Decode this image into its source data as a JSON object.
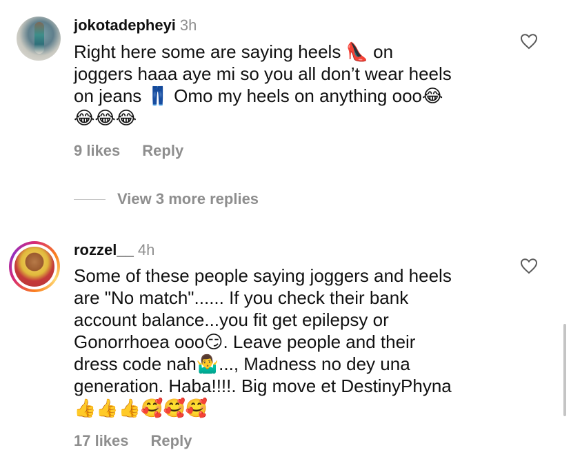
{
  "comments": [
    {
      "username": "jokotadepheyi",
      "time": "3h",
      "lines": [
        "Right here some are saying heels 👠 on",
        "joggers haaa aye mi so you all don’t wear heels",
        "on jeans 👖 Omo my heels on anything ooo😂",
        "😂😂😂"
      ],
      "likes": "9 likes",
      "reply": "Reply"
    },
    {
      "username": "rozzel__",
      "time": "4h",
      "lines": [
        "Some of these people saying joggers and heels",
        "are \"No match\"...... If you check their bank",
        "account balance...you fit get epilepsy or",
        "Gonorrhoea ooo😏. Leave people and their",
        "dress code nah🤷‍♂️..., Madness no dey una",
        "generation. Haba!!!!. Big move et DestinyPhyna",
        "👍👍👍🥰🥰🥰"
      ],
      "likes": "17 likes",
      "reply": "Reply"
    }
  ],
  "view_replies": "View 3 more replies",
  "icons": {
    "like": "heart-outline-icon"
  }
}
